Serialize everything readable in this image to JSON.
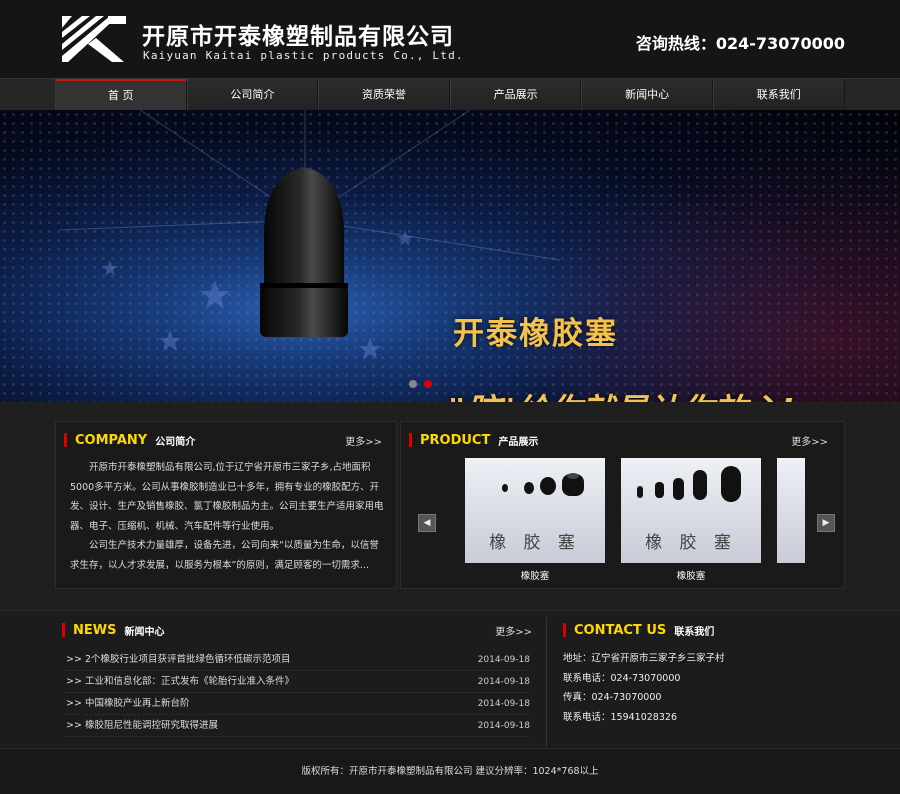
{
  "header": {
    "title_cn": "开原市开泰橡塑制品有限公司",
    "title_en": "Kaiyuan Kaitai plastic products Co., Ltd.",
    "hotline": "咨询热线：024-73070000"
  },
  "nav": {
    "items": [
      {
        "label": "首 页"
      },
      {
        "label": "公司简介"
      },
      {
        "label": "资质荣誉"
      },
      {
        "label": "产品展示"
      },
      {
        "label": "新闻中心"
      },
      {
        "label": "联系我们"
      }
    ],
    "active_index": 0
  },
  "banner": {
    "title": "开泰橡胶塞",
    "slogan": "\"胶\"给你就是让你放心!",
    "active_dot": 2
  },
  "company": {
    "en": "COMPANY",
    "cn": "公司简介",
    "more": "更多>>",
    "paragraphs": [
      "开原市开泰橡塑制品有限公司,位于辽宁省开原市三家子乡,占地面积5000多平方米。公司从事橡胶制造业已十多年，拥有专业的橡胶配方、开发、设计、生产及销售橡胶、氯丁橡胶制品为主。公司主要生产适用家用电器、电子、压缩机、机械、汽车配件等行业使用。",
      "公司生产技术力量雄厚，设备先进，公司向来“以质量为生命，以信誉求生存，以人才求发展，以服务为根本”的原则，满足顾客的一切需求..."
    ]
  },
  "product": {
    "en": "PRODUCT",
    "cn": "产品展示",
    "more": "更多>>",
    "items": [
      {
        "caption": "橡胶塞",
        "image_text": "橡 胶 塞"
      },
      {
        "caption": "橡胶塞",
        "image_text": "橡 胶 塞"
      }
    ]
  },
  "news": {
    "en": "NEWS",
    "cn": "新闻中心",
    "more": "更多>>",
    "items": [
      {
        "title": ">> 2个橡胶行业项目获评首批绿色循环低碳示范项目",
        "date": "2014-09-18"
      },
      {
        "title": ">> 工业和信息化部：正式发布《轮胎行业准入条件》",
        "date": "2014-09-18"
      },
      {
        "title": ">> 中国橡胶产业再上新台阶",
        "date": "2014-09-18"
      },
      {
        "title": ">> 橡胶阻尼性能调控研究取得进展",
        "date": "2014-09-18"
      }
    ]
  },
  "contact": {
    "en": "CONTACT US",
    "cn": "联系我们",
    "lines": [
      "地址：辽宁省开原市三家子乡三家子村",
      "联系电话：024-73070000",
      "传真：024-73070000",
      "联系电话：15941028326"
    ]
  },
  "footer": {
    "text": "版权所有：开原市开泰橡塑制品有限公司 建议分辨率：1024*768以上"
  },
  "colors": {
    "accent_red": "#cc1111",
    "heading_yellow": "#ffd800",
    "banner_gold": "#f2c14e"
  }
}
